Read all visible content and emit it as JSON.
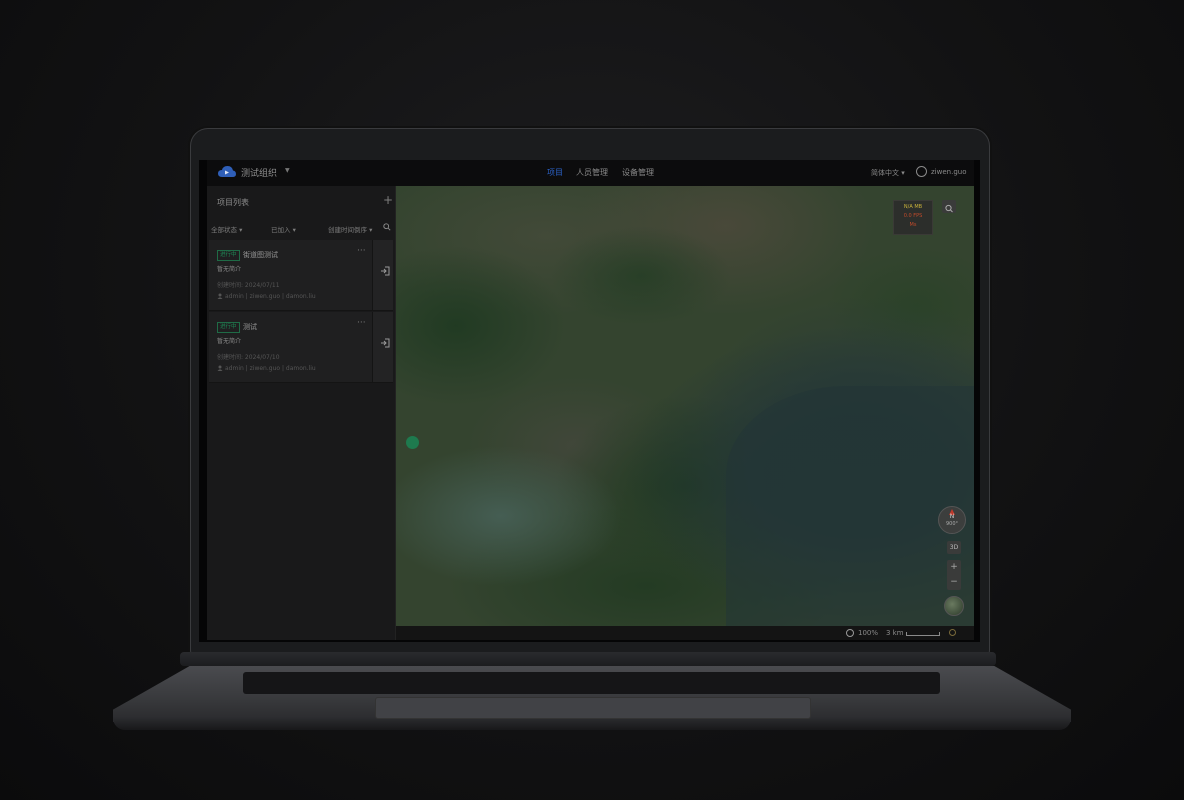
{
  "header": {
    "org_name": "测试组织",
    "nav": [
      {
        "label": "项目",
        "active": true
      },
      {
        "label": "人员管理",
        "active": false
      },
      {
        "label": "设备管理",
        "active": false
      }
    ],
    "language": "简体中文 ▾",
    "username": "ziwen.guo"
  },
  "sidebar": {
    "title": "项目列表",
    "add_label": "+",
    "filters": [
      "全部状态 ▾",
      "已加入 ▾",
      "创建时间倒序 ▾"
    ],
    "projects": [
      {
        "status": "进行中",
        "name": "街道图测试",
        "desc": "暂无简介",
        "created": "创建时间: 2024/07/11",
        "members": "admin | ziwen.guo | damon.liu"
      },
      {
        "status": "进行中",
        "name": "测试",
        "desc": "暂无简介",
        "created": "创建时间: 2024/07/10",
        "members": "admin | ziwen.guo | damon.liu"
      }
    ]
  },
  "map": {
    "hud_lines": [
      "N/A MB",
      "0.0 FPS",
      "Ms"
    ],
    "compass_letter": "N",
    "compass_degree": "900°",
    "btn_3d": "3D",
    "zoom_in": "+",
    "zoom_out": "−",
    "zoom_percent": "100%",
    "scale_label": "3 km",
    "colors": {
      "accent": "#2c63c9",
      "status_green": "#1f8a56"
    }
  }
}
